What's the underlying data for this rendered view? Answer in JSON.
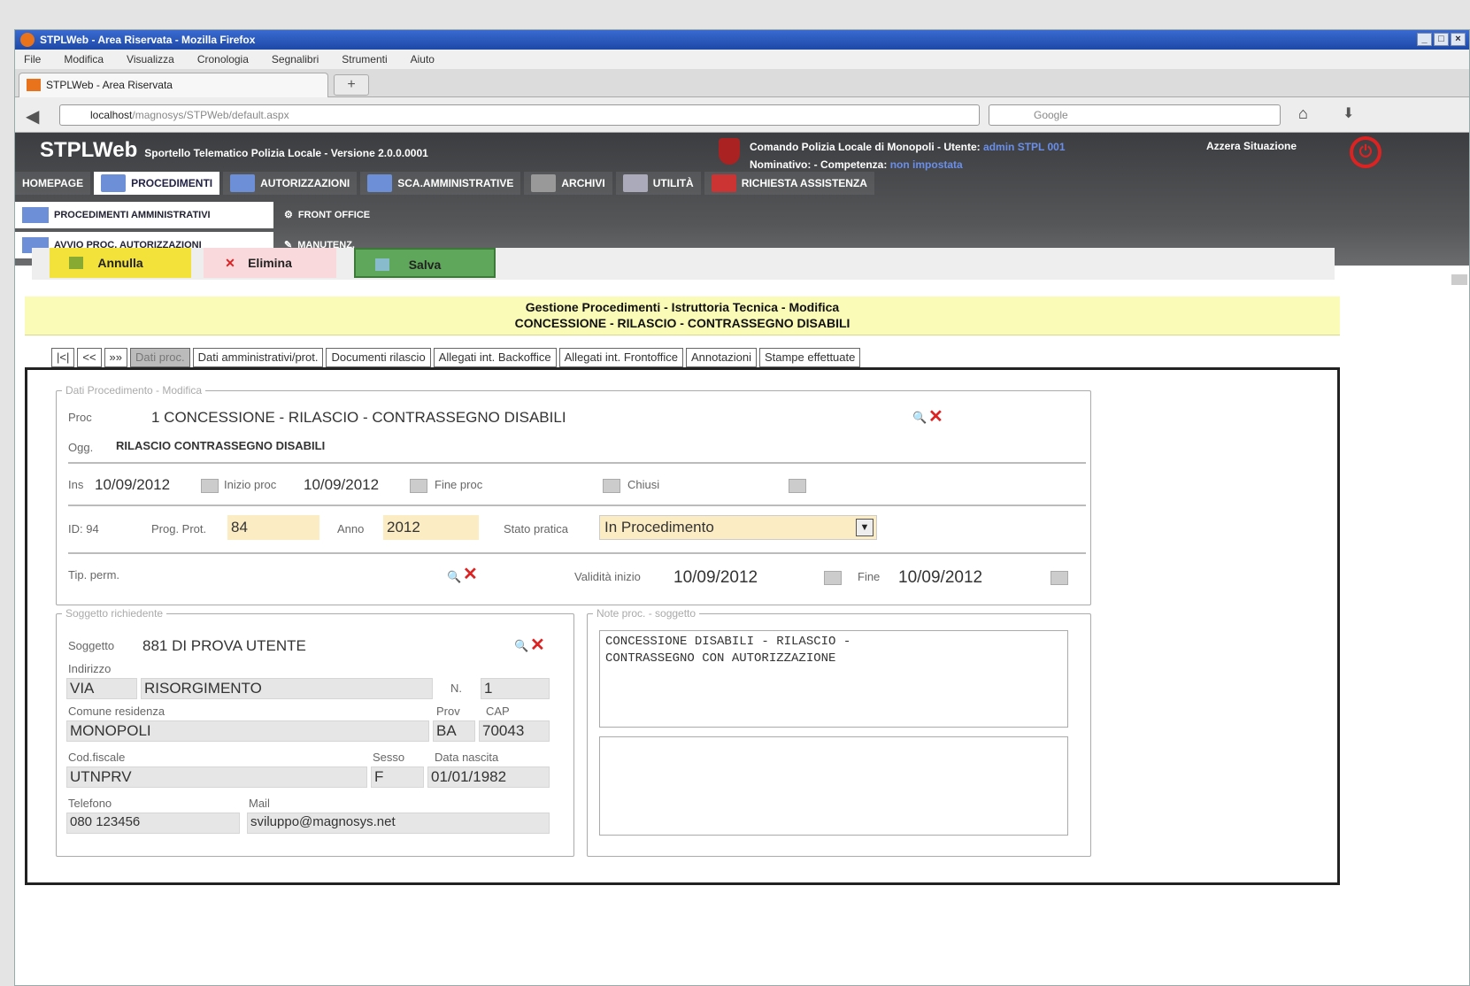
{
  "window": {
    "title": "STPLWeb - Area Riservata - Mozilla Firefox",
    "controls": [
      "_",
      "□",
      "×"
    ]
  },
  "menu": [
    "File",
    "Modifica",
    "Visualizza",
    "Cronologia",
    "Segnalibri",
    "Strumenti",
    "Aiuto"
  ],
  "browser": {
    "tab_title": "STPLWeb - Area Riservata",
    "new_tab": "+",
    "url_host": "localhost",
    "url_rest": "/magnosys/STPWeb/default.aspx",
    "search_placeholder": "Google"
  },
  "app": {
    "name": "STPLWeb",
    "subtitle": "Sportello Telematico Polizia Locale - Versione 2.0.0.0001",
    "comando_label": "Comando Polizia Locale di Monopoli",
    "utente_label": "Utente:",
    "utente_value": "admin STPL 001",
    "nominativo_label": "Nominativo:",
    "competenza_label": "Competenza:",
    "competenza_value": "non impostata",
    "azzera": "Azzera Situazione"
  },
  "main_menu": [
    {
      "label": "HOMEPAGE",
      "icon": "home-icon"
    },
    {
      "label": "PROCEDIMENTI",
      "icon": "folder-icon"
    },
    {
      "label": "AUTORIZZAZIONI",
      "icon": "document-icon"
    },
    {
      "label": "SCA.AMMINISTRATIVE",
      "icon": "fc-icon"
    },
    {
      "label": "ARCHIVI",
      "icon": "archive-icon"
    },
    {
      "label": "UTILITÀ",
      "icon": "tools-icon"
    },
    {
      "label": "RICHIESTA ASSISTENZA",
      "icon": "help-icon"
    }
  ],
  "sub_menu": [
    {
      "label": "PROCEDIMENTI AMMINISTRATIVI"
    },
    {
      "label": "FRONT OFFICE"
    },
    {
      "label": "AVVIO PROC. AUTORIZZAZIONI"
    },
    {
      "label": "MANUTENZ."
    }
  ],
  "actions": {
    "annulla": "Annulla",
    "elimina": "Elimina",
    "salva": "Salva"
  },
  "form": {
    "title1": "Gestione Procedimenti - Istruttoria Tecnica - Modifica",
    "title2": "CONCESSIONE - RILASCIO - CONTRASSEGNO DISABILI",
    "nav": [
      "|<|",
      "<<",
      "»»"
    ],
    "tabs": [
      "Dati proc.",
      "Dati amministrativi/prot.",
      "Documenti rilascio",
      "Allegati int. Backoffice",
      "Allegati int. Frontoffice",
      "Annotazioni",
      "Stampe effettuate"
    ],
    "sec1_legend": "Dati Procedimento - Modifica",
    "proc_label": "Proc",
    "proc_value": "1 CONCESSIONE - RILASCIO - CONTRASSEGNO DISABILI",
    "ogg_label": "Ogg.",
    "ogg_value": "RILASCIO CONTRASSEGNO DISABILI",
    "ins_label": "Ins",
    "ins_value": "10/09/2012",
    "inizio_label": "Inizio proc",
    "inizio_value": "10/09/2012",
    "fine_label": "Fine proc",
    "fine_value": "",
    "chiusi_label": "Chiusi",
    "chiusi_value": "",
    "id_label": "ID: 94",
    "prog_label": "Prog. Prot.",
    "prog_value": "84",
    "anno_label": "Anno",
    "anno_value": "2012",
    "stato_label": "Stato pratica",
    "stato_value": "In Procedimento",
    "tipo_label": "Tip. perm.",
    "tipo_value": "",
    "validita_label": "Validità inizio",
    "validita_value": "10/09/2012",
    "fine2_label": "Fine",
    "fine2_value": "10/09/2012",
    "sec2_legend": "Soggetto richiedente",
    "soggetto_label": "Soggetto",
    "soggetto_value": "881 DI PROVA UTENTE",
    "indirizzo_label": "Indirizzo",
    "via_value": "VIA",
    "indirizzo_value": "RISORGIMENTO",
    "n_label": "N.",
    "n_value": "1",
    "comune_label": "Comune residenza",
    "comune_value": "MONOPOLI",
    "prov_label": "Prov",
    "prov_value": "BA",
    "cap_label": "CAP",
    "cap_value": "70043",
    "cf_label": "Cod.fiscale",
    "cf_value": "UTNPRV",
    "sesso_label": "Sesso",
    "sesso_value": "F",
    "nascita_label": "Data nascita",
    "nascita_value": "01/01/1982",
    "tel_label": "Telefono",
    "tel_value": "080 123456",
    "mail_label": "Mail",
    "mail_value": "sviluppo@magnosys.net",
    "sec3_legend": "Note proc. - soggetto",
    "note_value": "CONCESSIONE DISABILI - RILASCIO -\nCONTRASSEGNO CON AUTORIZZAZIONE",
    "note2_value": ""
  },
  "colors": {
    "annulla": "#f2e23a",
    "elimina": "#f9d9dc",
    "salva": "#5fa75a",
    "header_yellow": "#fbfbb8",
    "field_yellow": "#fbecc4",
    "delete_red": "#dd2222"
  }
}
